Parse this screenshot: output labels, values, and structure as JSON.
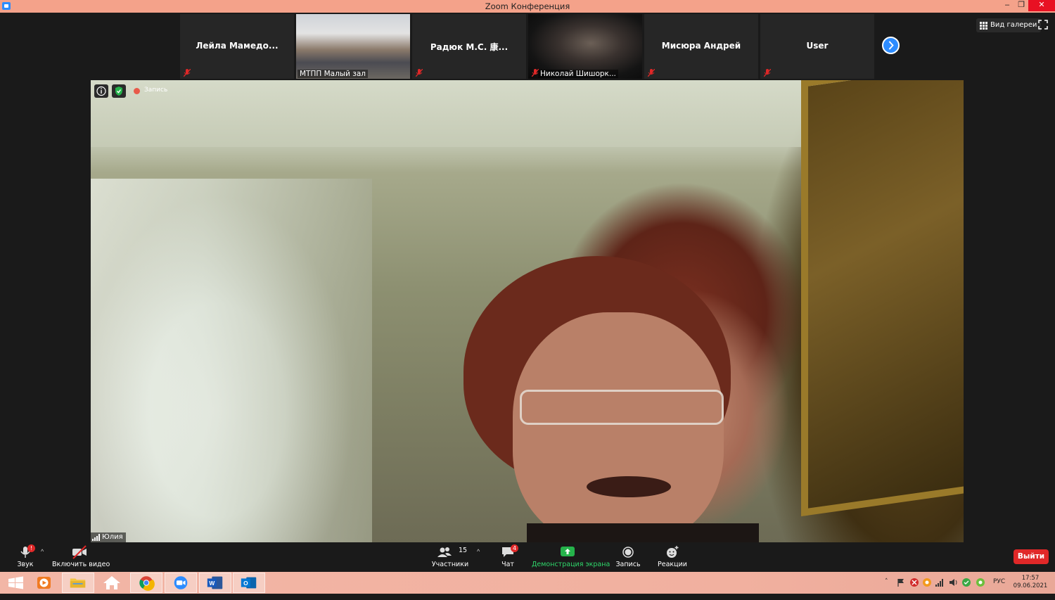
{
  "window": {
    "title": "Zoom Конференция",
    "minimize_glyph": "–",
    "maximize_glyph": "❐",
    "close_glyph": "✕"
  },
  "gallery": {
    "participants": [
      {
        "name": "Лейла  Мамедо...",
        "has_video": false,
        "muted": true
      },
      {
        "name": "МТПП Малый зал",
        "has_video": true,
        "muted": false
      },
      {
        "name": "Радюк  М.С. 康...",
        "has_video": false,
        "muted": true
      },
      {
        "name": "Николай Шишорк...",
        "has_video": true,
        "muted": true
      },
      {
        "name": "Мисюра Андрей",
        "has_video": false,
        "muted": true
      },
      {
        "name": "User",
        "has_video": false,
        "muted": true
      }
    ],
    "view_button_label": "Вид галереи",
    "icons": {
      "next": "chevron-right-icon",
      "grid": "grid-icon",
      "fullscreen": "fullscreen-icon"
    }
  },
  "main_video": {
    "speaker_name": "Юлия",
    "recording_label": "Запись"
  },
  "toolbar": {
    "audio_label": "Звук",
    "video_label": "Включить видео",
    "participants_label": "Участники",
    "participants_count": "15",
    "chat_label": "Чат",
    "chat_badge": "4",
    "share_label": "Демонстрация экрана",
    "record_label": "Запись",
    "reactions_label": "Реакции",
    "leave_label": "Выйти",
    "audio_alert": "!"
  },
  "taskbar": {
    "language": "РУС",
    "time": "17:57",
    "date": "09.06.2021"
  },
  "colors": {
    "accent": "#2d8cff",
    "danger": "#e02828",
    "share_green": "#2fd86b",
    "titlebar": "#f4a28a"
  }
}
